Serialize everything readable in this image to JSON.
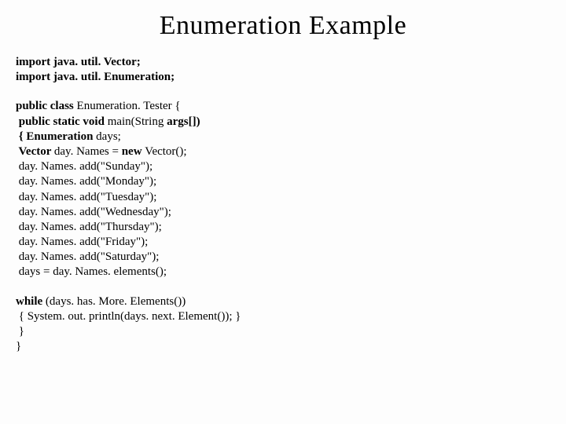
{
  "title": "Enumeration Example",
  "imports": {
    "l1": "import java. util. Vector;",
    "l2": "import java. util. Enumeration;"
  },
  "main": {
    "l1a": "public class ",
    "l1b": "Enumeration. Tester {",
    "l2a": " public static void ",
    "l2b": "main(String ",
    "l2c": "args[])",
    "l3a": " { Enumeration ",
    "l3b": "days;",
    "l4a": " Vector ",
    "l4b": "day. Names = ",
    "l4c": "new ",
    "l4d": "Vector();",
    "l5": " day. Names. add(\"Sunday\");",
    "l6": " day. Names. add(\"Monday\");",
    "l7": " day. Names. add(\"Tuesday\");",
    "l8": " day. Names. add(\"Wednesday\");",
    "l9": " day. Names. add(\"Thursday\");",
    "l10": " day. Names. add(\"Friday\");",
    "l11": " day. Names. add(\"Saturday\");",
    "l12": " days = day. Names. elements();"
  },
  "loop": {
    "l1a": "while ",
    "l1b": "(days. has. More. Elements())",
    "l2": " { System. out. println(days. next. Element()); }",
    "l3": " }",
    "l4": "}"
  }
}
